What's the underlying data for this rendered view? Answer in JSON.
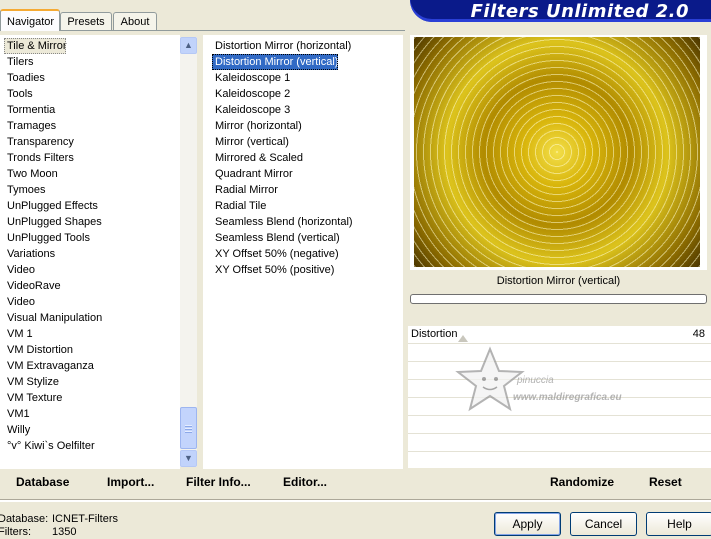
{
  "tabs": [
    {
      "label": "Navigator",
      "active": true
    },
    {
      "label": "Presets",
      "active": false
    },
    {
      "label": "About",
      "active": false
    }
  ],
  "app_title": "Filters Unlimited 2.0",
  "categories": [
    "Tile & Mirror",
    "Tilers",
    "Toadies",
    "Tools",
    "Tormentia",
    "Tramages",
    "Transparency",
    "Tronds Filters",
    "Two Moon",
    "Tymoes",
    "UnPlugged Effects",
    "UnPlugged Shapes",
    "UnPlugged Tools",
    "Variations",
    "Video",
    "VideoRave",
    "Video",
    "Visual Manipulation",
    "VM 1",
    "VM Distortion",
    "VM Extravaganza",
    "VM Stylize",
    "VM Texture",
    "VM1",
    "Willy",
    "°v° Kiwi`s Oelfilter"
  ],
  "selected_category_index": 0,
  "filters": [
    "Distortion Mirror (horizontal)",
    "Distortion Mirror (vertical)",
    "Kaleidoscope 1",
    "Kaleidoscope 2",
    "Kaleidoscope 3",
    "Mirror (horizontal)",
    "Mirror (vertical)",
    "Mirrored & Scaled",
    "Quadrant Mirror",
    "Radial Mirror",
    "Radial Tile",
    "Seamless Blend (horizontal)",
    "Seamless Blend (vertical)",
    "XY Offset 50% (negative)",
    "XY Offset 50% (positive)"
  ],
  "selected_filter_index": 1,
  "preview_caption": "Distortion Mirror (vertical)",
  "sliders": [
    {
      "label": "Distortion",
      "value": "48"
    }
  ],
  "watermark": {
    "line1": "pinuccia",
    "line2": "www.maldiregrafica.eu"
  },
  "bottom_buttons": {
    "database": "Database",
    "import": "Import...",
    "filter_info": "Filter Info...",
    "editor": "Editor...",
    "randomize": "Randomize",
    "reset": "Reset"
  },
  "info": {
    "database_label": "Database:",
    "database_value": "ICNET-Filters",
    "filters_label": "Filters:",
    "filters_value": "1350"
  },
  "dialog_buttons": {
    "apply": "Apply",
    "cancel": "Cancel",
    "help": "Help"
  },
  "colors": {
    "banner": "#0a1a8a",
    "selection": "#316ac5",
    "dialog_bg": "#ece9d8"
  },
  "icons": {
    "scroll_up": "chevron-up-icon",
    "scroll_down": "chevron-down-icon",
    "watermark": "star-icon"
  }
}
